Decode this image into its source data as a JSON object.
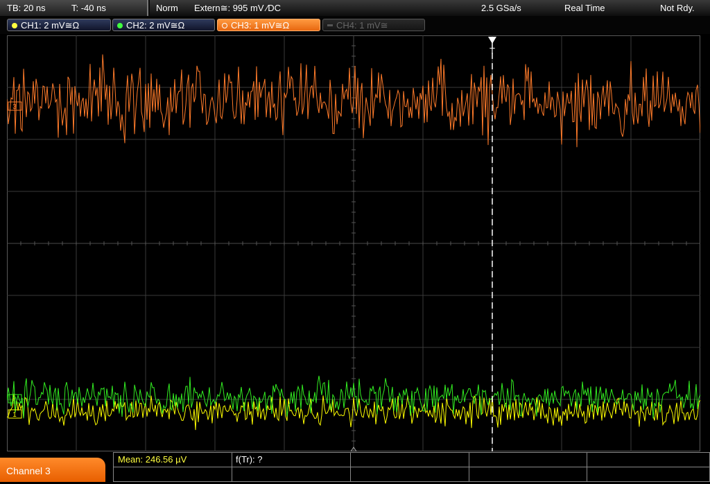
{
  "status": {
    "timebase": "TB: 20 ns",
    "trigger_time": "T: -40 ns",
    "mode": "Norm",
    "trigger_source": "Extern≅: 995 mV ⁄DC",
    "sample_rate": "2.5 GSa/s",
    "acq_mode": "Real Time",
    "ready_state": "Not Rdy."
  },
  "channels": [
    {
      "label": "CH1: 2 mV≅Ω",
      "color": "#ffff00"
    },
    {
      "label": "CH2: 2 mV≅Ω",
      "color": "#40ff40"
    },
    {
      "label": "CH3: 1 mV≅Ω",
      "color": "#ff8c30"
    },
    {
      "label": "CH4: 1 mV≅",
      "color": "#666666"
    }
  ],
  "trigger_marker": "T",
  "ch_markers": {
    "ch3": "3",
    "ch2": "2",
    "ch1": "1"
  },
  "bottom": {
    "channel_label": "Channel 3",
    "mean": "Mean: 246.56 µV",
    "freq": "f(Tr): ?"
  },
  "colors": {
    "ch1": "#ffff00",
    "ch2": "#33ee22",
    "ch3": "#ff7b2a",
    "grid": "#3a3a3a"
  },
  "trace_levels": {
    "ch3_divisions_from_top": 1.0,
    "ch2_divisions_from_top": 6.75,
    "ch1_divisions_from_top": 6.9
  }
}
